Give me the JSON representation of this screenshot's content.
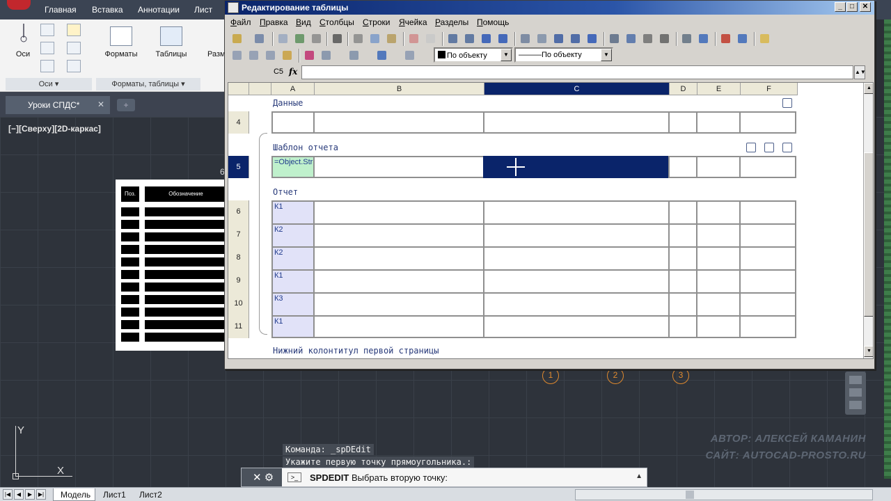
{
  "ribbon": {
    "tabs": [
      "Главная",
      "Вставка",
      "Аннотации",
      "Лист"
    ],
    "buttons": {
      "axes": "Оси",
      "formats": "Форматы",
      "tables": "Таблицы",
      "razm": "Разм"
    },
    "groups": {
      "axes": "Оси ▾",
      "formats_tables": "Форматы, таблицы ▾"
    }
  },
  "document_tab": {
    "name": "Уроки СПДС*",
    "close": "✕",
    "add": "+"
  },
  "viewport_label": "[−][Сверху][2D-каркас]",
  "drawing_table": {
    "col1": "Поз.",
    "col2": "Обозначение"
  },
  "stray_digit": "6",
  "bubbles": [
    "1",
    "2",
    "3"
  ],
  "ucs": {
    "y": "Y",
    "x": "X"
  },
  "command_history": [
    "Команда: _spDEdit",
    "Укажите первую точку прямоугольника.:"
  ],
  "command_line": {
    "command": "SPDEDIT",
    "prompt": "Выбрать вторую точку:"
  },
  "watermark": [
    "АВТОР: АЛЕКСЕЙ КАМАНИН",
    "САЙТ: AUTOCAD-PROSTO.RU"
  ],
  "layout_tabs": [
    "Модель",
    "Лист1",
    "Лист2"
  ],
  "editor": {
    "title": "Редактирование таблицы",
    "window_buttons": [
      "_",
      "□",
      "✕"
    ],
    "menu": [
      "Файл",
      "Правка",
      "Вид",
      "Столбцы",
      "Строки",
      "Ячейка",
      "Разделы",
      "Помощь"
    ],
    "color_combo": "По объекту",
    "linetype_combo": "———По объекту",
    "cell_ref": "C5",
    "fx": "fx",
    "columns": [
      "A",
      "B",
      "C",
      "D",
      "E",
      "F"
    ],
    "selected_column": "C",
    "sections": {
      "data": "Данные",
      "template": "Шаблон отчета",
      "report": "Отчет",
      "footer": "Нижний колонтитул первой страницы"
    },
    "rows": {
      "data_row": "4",
      "template_row": "5",
      "report_rows": [
        "6",
        "7",
        "8",
        "9",
        "10",
        "11"
      ]
    },
    "template_cell_a": "=Object.Str",
    "report_values": [
      "К1",
      "К2",
      "К2",
      "К1",
      "К3",
      "К1"
    ]
  },
  "colors": {
    "selection": "#0a246a",
    "template_cell": "#bff0cc",
    "report_col_a": "#e1e2f8",
    "bubble": "#e08a2e"
  }
}
